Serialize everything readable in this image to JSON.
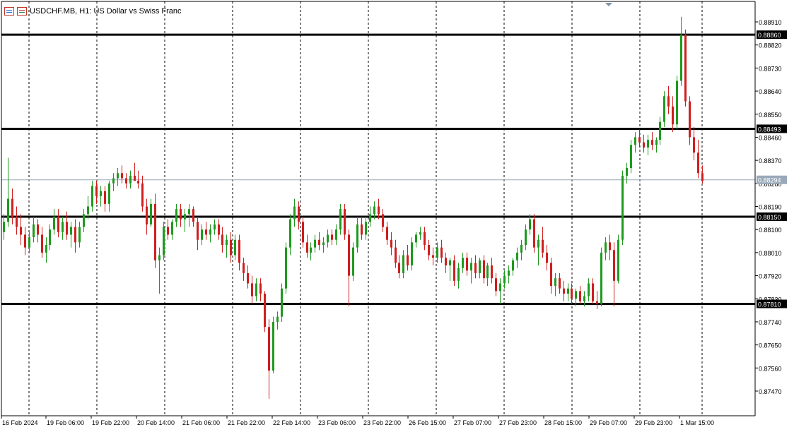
{
  "header": {
    "title": "USDCHF.MB, H1:  US Dollar vs Swiss Franc",
    "icons": [
      "one-click-trading-icon",
      "chart-properties-icon"
    ]
  },
  "colors": {
    "bull": "#1e9a1e",
    "bear": "#d01e1e",
    "level_line": "#000000",
    "grid": "#000000",
    "price_line": "#9aa9b9"
  },
  "chart_data": {
    "type": "candlestick",
    "symbol": "USDCHF.MB",
    "timeframe": "H1",
    "ylim": [
      0.8738,
      0.8896
    ],
    "price_ticks": [
      "0.88910",
      "0.88820",
      "0.88730",
      "0.88640",
      "0.88550",
      "0.88460",
      "0.88370",
      "0.88280",
      "0.88190",
      "0.88100",
      "0.88010",
      "0.87920",
      "0.87830",
      "0.87740",
      "0.87650",
      "0.87560",
      "0.87470"
    ],
    "time_labels": [
      "16 Feb 2024",
      "19 Feb 06:00",
      "19 Feb 22:00",
      "20 Feb 14:00",
      "21 Feb 06:00",
      "21 Feb 22:00",
      "22 Feb 14:00",
      "23 Feb 06:00",
      "23 Feb 22:00",
      "26 Feb 15:00",
      "27 Feb 07:00",
      "27 Feb 23:00",
      "28 Feb 15:00",
      "29 Feb 07:00",
      "29 Feb 23:00",
      "1 Mar 15:00"
    ],
    "levels": [
      {
        "value": 0.8886,
        "label": "0.88860"
      },
      {
        "value": 0.88493,
        "label": "0.88493"
      },
      {
        "value": 0.8815,
        "label": "0.88150"
      },
      {
        "value": 0.8781,
        "label": "0.87810"
      }
    ],
    "current_price": {
      "value": 0.88294,
      "label": "0.88294"
    },
    "candles": [
      [
        0.8809,
        0.8816,
        0.8806,
        0.8813
      ],
      [
        0.8813,
        0.8838,
        0.8811,
        0.8822
      ],
      [
        0.8822,
        0.8826,
        0.8812,
        0.8815
      ],
      [
        0.8815,
        0.8819,
        0.8808,
        0.8811
      ],
      [
        0.8811,
        0.8816,
        0.8804,
        0.8808
      ],
      [
        0.8808,
        0.8811,
        0.88,
        0.8803
      ],
      [
        0.8803,
        0.8809,
        0.8801,
        0.8807
      ],
      [
        0.8807,
        0.8815,
        0.8805,
        0.8812
      ],
      [
        0.8812,
        0.8814,
        0.8805,
        0.8808
      ],
      [
        0.8808,
        0.8811,
        0.8799,
        0.8801
      ],
      [
        0.8801,
        0.8807,
        0.8797,
        0.8804
      ],
      [
        0.8804,
        0.8812,
        0.8802,
        0.881
      ],
      [
        0.881,
        0.8818,
        0.8808,
        0.8815
      ],
      [
        0.8815,
        0.8818,
        0.8807,
        0.8809
      ],
      [
        0.8809,
        0.8815,
        0.8806,
        0.8813
      ],
      [
        0.8813,
        0.8817,
        0.8806,
        0.8808
      ],
      [
        0.8808,
        0.8813,
        0.8803,
        0.8811
      ],
      [
        0.8811,
        0.8814,
        0.8801,
        0.8805
      ],
      [
        0.8805,
        0.8813,
        0.8803,
        0.8811
      ],
      [
        0.8811,
        0.8818,
        0.8809,
        0.8816
      ],
      [
        0.8816,
        0.8823,
        0.8814,
        0.8819
      ],
      [
        0.8819,
        0.8829,
        0.8817,
        0.8827
      ],
      [
        0.8827,
        0.8829,
        0.882,
        0.8823
      ],
      [
        0.8823,
        0.8827,
        0.8819,
        0.8825
      ],
      [
        0.8825,
        0.8827,
        0.8817,
        0.882
      ],
      [
        0.882,
        0.8829,
        0.8817,
        0.8828
      ],
      [
        0.8828,
        0.8832,
        0.8825,
        0.883
      ],
      [
        0.883,
        0.8834,
        0.8827,
        0.8832
      ],
      [
        0.8832,
        0.8835,
        0.8828,
        0.883
      ],
      [
        0.883,
        0.8832,
        0.8826,
        0.8828
      ],
      [
        0.8828,
        0.8833,
        0.8826,
        0.8831
      ],
      [
        0.8831,
        0.8836,
        0.8829,
        0.8829
      ],
      [
        0.8829,
        0.8833,
        0.8826,
        0.8828
      ],
      [
        0.8828,
        0.8831,
        0.8817,
        0.8819
      ],
      [
        0.8819,
        0.8822,
        0.8808,
        0.8812
      ],
      [
        0.8812,
        0.8822,
        0.8811,
        0.882
      ],
      [
        0.882,
        0.8824,
        0.8795,
        0.8798
      ],
      [
        0.8798,
        0.8803,
        0.8785,
        0.88
      ],
      [
        0.88,
        0.8813,
        0.8798,
        0.8811
      ],
      [
        0.8811,
        0.8814,
        0.8806,
        0.8808
      ],
      [
        0.8808,
        0.8814,
        0.8806,
        0.8813
      ],
      [
        0.8813,
        0.882,
        0.8811,
        0.8818
      ],
      [
        0.8818,
        0.882,
        0.8811,
        0.8814
      ],
      [
        0.8814,
        0.8818,
        0.8809,
        0.8816
      ],
      [
        0.8816,
        0.882,
        0.8811,
        0.8818
      ],
      [
        0.8818,
        0.8819,
        0.8811,
        0.8813
      ],
      [
        0.8813,
        0.8815,
        0.8802,
        0.8806
      ],
      [
        0.8806,
        0.8812,
        0.8804,
        0.881
      ],
      [
        0.881,
        0.8813,
        0.8806,
        0.8808
      ],
      [
        0.8808,
        0.8812,
        0.8805,
        0.881
      ],
      [
        0.881,
        0.8814,
        0.8808,
        0.8812
      ],
      [
        0.8812,
        0.8814,
        0.8806,
        0.8808
      ],
      [
        0.8808,
        0.8811,
        0.8801,
        0.8804
      ],
      [
        0.8804,
        0.8808,
        0.8799,
        0.8806
      ],
      [
        0.8806,
        0.8809,
        0.8797,
        0.88
      ],
      [
        0.88,
        0.8808,
        0.8798,
        0.8806
      ],
      [
        0.8806,
        0.8808,
        0.8794,
        0.8797
      ],
      [
        0.8797,
        0.8799,
        0.879,
        0.8793
      ],
      [
        0.8793,
        0.8796,
        0.8787,
        0.8789
      ],
      [
        0.8789,
        0.8792,
        0.8781,
        0.8784
      ],
      [
        0.8784,
        0.8791,
        0.8782,
        0.8789
      ],
      [
        0.8789,
        0.8791,
        0.8782,
        0.8785
      ],
      [
        0.8785,
        0.8786,
        0.877,
        0.8772
      ],
      [
        0.8772,
        0.8775,
        0.8744,
        0.8755
      ],
      [
        0.8755,
        0.8776,
        0.8754,
        0.8774
      ],
      [
        0.8774,
        0.8778,
        0.8771,
        0.8776
      ],
      [
        0.8776,
        0.8789,
        0.8774,
        0.8787
      ],
      [
        0.8787,
        0.8805,
        0.8785,
        0.8803
      ],
      [
        0.8803,
        0.8816,
        0.88,
        0.8814
      ],
      [
        0.8814,
        0.8822,
        0.8811,
        0.8819
      ],
      [
        0.8819,
        0.8821,
        0.881,
        0.8813
      ],
      [
        0.8813,
        0.8815,
        0.8803,
        0.8805
      ],
      [
        0.8805,
        0.8808,
        0.8799,
        0.8801
      ],
      [
        0.8801,
        0.8805,
        0.8798,
        0.8803
      ],
      [
        0.8803,
        0.8808,
        0.8801,
        0.8806
      ],
      [
        0.8806,
        0.8809,
        0.8802,
        0.8804
      ],
      [
        0.8804,
        0.8807,
        0.8801,
        0.8805
      ],
      [
        0.8805,
        0.881,
        0.8803,
        0.8808
      ],
      [
        0.8808,
        0.881,
        0.8804,
        0.8806
      ],
      [
        0.8806,
        0.8812,
        0.8804,
        0.881
      ],
      [
        0.881,
        0.882,
        0.8808,
        0.8818
      ],
      [
        0.8818,
        0.882,
        0.8806,
        0.8808
      ],
      [
        0.8808,
        0.881,
        0.878,
        0.8792
      ],
      [
        0.8792,
        0.8805,
        0.879,
        0.8803
      ],
      [
        0.8803,
        0.8815,
        0.8801,
        0.8812
      ],
      [
        0.8812,
        0.8815,
        0.8806,
        0.8808
      ],
      [
        0.8808,
        0.8815,
        0.8806,
        0.8813
      ],
      [
        0.8813,
        0.8819,
        0.8811,
        0.8816
      ],
      [
        0.8816,
        0.8821,
        0.8814,
        0.8819
      ],
      [
        0.8819,
        0.8822,
        0.8814,
        0.8816
      ],
      [
        0.8816,
        0.8818,
        0.8809,
        0.8811
      ],
      [
        0.8811,
        0.8813,
        0.8804,
        0.8806
      ],
      [
        0.8806,
        0.8809,
        0.88,
        0.8803
      ],
      [
        0.8803,
        0.8806,
        0.8795,
        0.8797
      ],
      [
        0.8797,
        0.88,
        0.8791,
        0.8793
      ],
      [
        0.8793,
        0.8802,
        0.8791,
        0.88
      ],
      [
        0.88,
        0.8804,
        0.8794,
        0.8796
      ],
      [
        0.8796,
        0.8807,
        0.8794,
        0.8805
      ],
      [
        0.8805,
        0.8809,
        0.8803,
        0.8808
      ],
      [
        0.8808,
        0.8811,
        0.8806,
        0.8809
      ],
      [
        0.8809,
        0.8811,
        0.8802,
        0.8804
      ],
      [
        0.8804,
        0.8806,
        0.8798,
        0.88
      ],
      [
        0.88,
        0.8803,
        0.8796,
        0.8799
      ],
      [
        0.8799,
        0.8805,
        0.8797,
        0.8803
      ],
      [
        0.8803,
        0.8806,
        0.8797,
        0.8799
      ],
      [
        0.8799,
        0.8801,
        0.8793,
        0.8796
      ],
      [
        0.8796,
        0.8799,
        0.879,
        0.8798
      ],
      [
        0.8798,
        0.88,
        0.8788,
        0.879
      ],
      [
        0.879,
        0.8797,
        0.8787,
        0.8795
      ],
      [
        0.8795,
        0.8801,
        0.8793,
        0.8799
      ],
      [
        0.8799,
        0.8801,
        0.8792,
        0.8794
      ],
      [
        0.8794,
        0.8799,
        0.8789,
        0.8797
      ],
      [
        0.8797,
        0.88,
        0.8791,
        0.8793
      ],
      [
        0.8793,
        0.8799,
        0.8791,
        0.8798
      ],
      [
        0.8798,
        0.88,
        0.8789,
        0.8791
      ],
      [
        0.8791,
        0.8797,
        0.8788,
        0.8796
      ],
      [
        0.8796,
        0.8799,
        0.8789,
        0.8791
      ],
      [
        0.8791,
        0.8793,
        0.8784,
        0.8786
      ],
      [
        0.8786,
        0.8791,
        0.8781,
        0.8789
      ],
      [
        0.8789,
        0.8794,
        0.8787,
        0.8792
      ],
      [
        0.8792,
        0.8796,
        0.8789,
        0.8794
      ],
      [
        0.8794,
        0.8799,
        0.8792,
        0.8798
      ],
      [
        0.8798,
        0.8803,
        0.8795,
        0.8801
      ],
      [
        0.8801,
        0.8806,
        0.8798,
        0.8804
      ],
      [
        0.8804,
        0.8812,
        0.8802,
        0.881
      ],
      [
        0.881,
        0.8816,
        0.8808,
        0.8814
      ],
      [
        0.8814,
        0.8816,
        0.8801,
        0.8803
      ],
      [
        0.8803,
        0.8808,
        0.8796,
        0.8806
      ],
      [
        0.8806,
        0.8811,
        0.8799,
        0.8801
      ],
      [
        0.8801,
        0.8804,
        0.8794,
        0.8797
      ],
      [
        0.8797,
        0.8799,
        0.8785,
        0.8788
      ],
      [
        0.8788,
        0.8793,
        0.8784,
        0.8791
      ],
      [
        0.8791,
        0.8793,
        0.8785,
        0.8787
      ],
      [
        0.8787,
        0.879,
        0.8782,
        0.8785
      ],
      [
        0.8785,
        0.8789,
        0.8782,
        0.8787
      ],
      [
        0.8787,
        0.8789,
        0.8781,
        0.8783
      ],
      [
        0.8783,
        0.8787,
        0.878,
        0.8786
      ],
      [
        0.8786,
        0.8788,
        0.8781,
        0.8782
      ],
      [
        0.8782,
        0.8786,
        0.878,
        0.8784
      ],
      [
        0.8784,
        0.8791,
        0.8782,
        0.8789
      ],
      [
        0.8789,
        0.8791,
        0.8781,
        0.8782
      ],
      [
        0.8782,
        0.8786,
        0.8779,
        0.8781
      ],
      [
        0.8781,
        0.8803,
        0.878,
        0.8801
      ],
      [
        0.8801,
        0.8807,
        0.8798,
        0.8805
      ],
      [
        0.8805,
        0.8808,
        0.8798,
        0.8802
      ],
      [
        0.8802,
        0.8805,
        0.878,
        0.879
      ],
      [
        0.879,
        0.8808,
        0.8789,
        0.8806
      ],
      [
        0.8806,
        0.8833,
        0.8804,
        0.8831
      ],
      [
        0.8831,
        0.8836,
        0.8828,
        0.8834
      ],
      [
        0.8834,
        0.8845,
        0.8832,
        0.8843
      ],
      [
        0.8843,
        0.8848,
        0.884,
        0.8846
      ],
      [
        0.8846,
        0.8849,
        0.8842,
        0.8844
      ],
      [
        0.8844,
        0.8847,
        0.884,
        0.8842
      ],
      [
        0.8842,
        0.8847,
        0.8839,
        0.8845
      ],
      [
        0.8845,
        0.8848,
        0.8841,
        0.8843
      ],
      [
        0.8843,
        0.8846,
        0.884,
        0.8845
      ],
      [
        0.8845,
        0.8854,
        0.8843,
        0.8852
      ],
      [
        0.8852,
        0.8864,
        0.885,
        0.8862
      ],
      [
        0.8862,
        0.8866,
        0.8855,
        0.8858
      ],
      [
        0.8858,
        0.8862,
        0.8848,
        0.8851
      ],
      [
        0.8851,
        0.887,
        0.8849,
        0.8868
      ],
      [
        0.8868,
        0.8893,
        0.8866,
        0.8886
      ],
      [
        0.8886,
        0.8888,
        0.8858,
        0.886
      ],
      [
        0.886,
        0.8862,
        0.8843,
        0.8846
      ],
      [
        0.8846,
        0.885,
        0.8837,
        0.884
      ],
      [
        0.884,
        0.8845,
        0.883,
        0.8832
      ],
      [
        0.8832,
        0.8835,
        0.8828,
        0.8829
      ]
    ]
  }
}
